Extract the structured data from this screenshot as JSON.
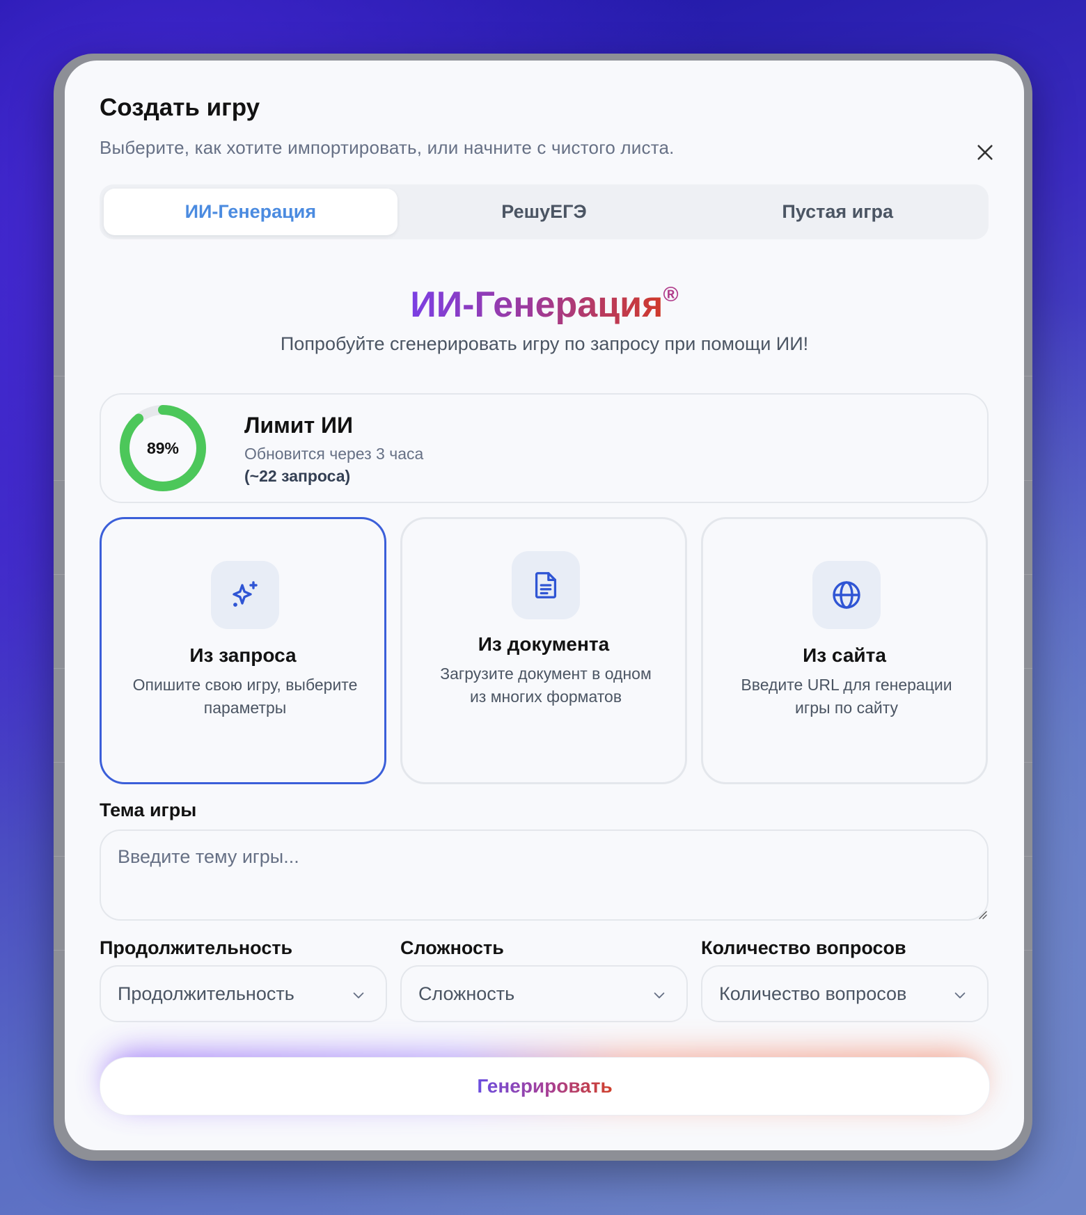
{
  "modal": {
    "title": "Создать игру",
    "subtitle": "Выберите, как хотите импортировать, или начните с чистого листа."
  },
  "tabs": [
    {
      "label": "ИИ-Генерация",
      "active": true
    },
    {
      "label": "РешуЕГЭ",
      "active": false
    },
    {
      "label": "Пустая игра",
      "active": false
    }
  ],
  "ai": {
    "heading": "ИИ-Генерация",
    "registered_mark": "®",
    "description": "Попробуйте сгенерировать игру по запросу при помощи ИИ!"
  },
  "limit": {
    "percent": 89,
    "percent_label": "89%",
    "title": "Лимит ИИ",
    "refresh": "Обновится через 3 часа",
    "requests": "(~22 запроса)",
    "ring_color": "#4cc75a"
  },
  "sources": [
    {
      "icon": "sparkles-icon",
      "title": "Из запроса",
      "desc": "Опишите свою игру, выберите параметры",
      "selected": true
    },
    {
      "icon": "document-icon",
      "title": "Из документа",
      "desc": "Загрузите документ в одном из многих форматов",
      "selected": false
    },
    {
      "icon": "globe-icon",
      "title": "Из сайта",
      "desc": "Введите URL для генерации игры по сайту",
      "selected": false
    }
  ],
  "topic": {
    "label": "Тема игры",
    "placeholder": "Введите тему игры...",
    "value": ""
  },
  "options": [
    {
      "label": "Продолжительность",
      "placeholder": "Продолжительность"
    },
    {
      "label": "Сложность",
      "placeholder": "Сложность"
    },
    {
      "label": "Количество вопросов",
      "placeholder": "Количество вопросов"
    }
  ],
  "generate_label": "Генерировать",
  "colors": {
    "accent": "#3b5fd9",
    "tab_active_text": "#4b8be0"
  }
}
